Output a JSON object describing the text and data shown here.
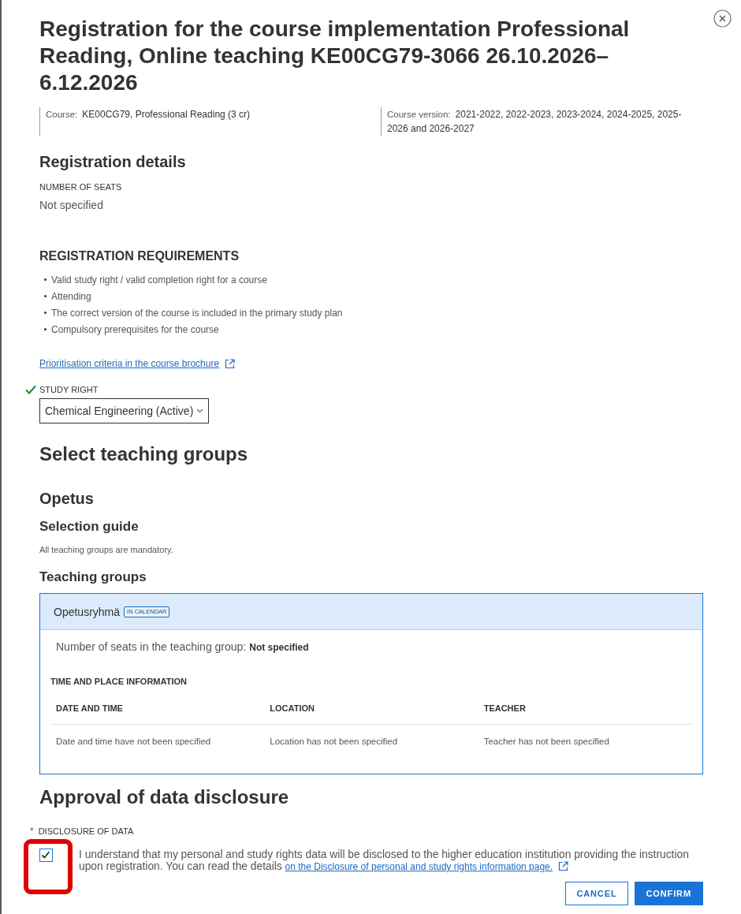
{
  "header": {
    "title": "Registration for the course implementation Professional Reading, Online teaching KE00CG79-3066 26.10.2026–6.12.2026",
    "meta": [
      {
        "label": "Course:",
        "value": "KE00CG79, Professional Reading (3 cr)"
      },
      {
        "label": "Course version:",
        "value": "2021-2022, 2022-2023, 2023-2024, 2024-2025, 2025-2026 and 2026-2027"
      }
    ]
  },
  "registration_details": {
    "heading": "Registration details",
    "seats_label": "NUMBER OF SEATS",
    "seats_value": "Not specified"
  },
  "requirements": {
    "heading": "REGISTRATION REQUIREMENTS",
    "items": [
      "Valid study right / valid completion right for a course",
      "Attending",
      "The correct version of the course is included in the primary study plan",
      "Compulsory prerequisites for the course"
    ],
    "link": "Prioritisation criteria in the course brochure"
  },
  "study_right": {
    "label": "STUDY RIGHT",
    "valid": true,
    "value": "Chemical Engineering (Active)"
  },
  "teaching": {
    "heading": "Select teaching groups",
    "subheading": "Opetus",
    "guide_heading": "Selection guide",
    "guide_text": "All teaching groups are mandatory.",
    "groups_heading": "Teaching groups",
    "groups": [
      {
        "name": "Opetusryhmä",
        "badge": "IN CALENDAR",
        "selected": true,
        "seats_label": "Number of seats in the teaching group:",
        "seats_value": "Not specified",
        "schedule_heading": "TIME AND PLACE INFORMATION",
        "table": {
          "columns": [
            "DATE AND TIME",
            "LOCATION",
            "TEACHER"
          ],
          "rows": [
            [
              "Date and time have not been specified",
              "Location has not been specified",
              "Teacher has not been specified"
            ]
          ]
        }
      }
    ]
  },
  "disclosure": {
    "heading": "Approval of data disclosure",
    "required_mark": "*",
    "label": "DISCLOSURE OF DATA",
    "checked": true,
    "highlighted": true,
    "text": "I understand that my personal and study rights data will be disclosed to the higher education institution providing the instruction upon registration. You can read the details",
    "link": "on the Disclosure of personal and study rights information page."
  },
  "buttons": [
    {
      "label": "CANCEL",
      "kind": "secondary"
    },
    {
      "label": "CONFIRM",
      "kind": "primary"
    }
  ]
}
